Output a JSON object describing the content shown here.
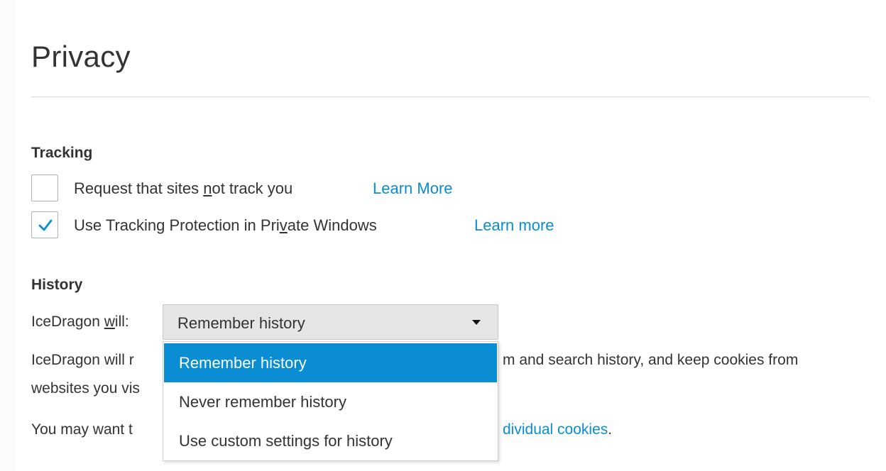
{
  "page": {
    "title": "Privacy"
  },
  "tracking": {
    "heading": "Tracking",
    "dnt": {
      "checked": false,
      "label_pre": "Request that sites ",
      "label_key": "n",
      "label_post": "ot track you",
      "link": "Learn More"
    },
    "protection": {
      "checked": true,
      "label_pre": "Use Tracking Protection in Pri",
      "label_key": "v",
      "label_post": "ate Windows",
      "link": "Learn more"
    }
  },
  "history": {
    "heading": "History",
    "will_pre": "IceDragon ",
    "will_key": "w",
    "will_post": "ill:",
    "select": {
      "value": "Remember history",
      "arrow_icon": "triangle-down-icon"
    },
    "options": [
      {
        "label": "Remember history",
        "selected": true
      },
      {
        "label": "Never remember history",
        "selected": false
      },
      {
        "label": "Use custom settings for history",
        "selected": false
      }
    ],
    "desc_line1_left": "IceDragon will r",
    "desc_line1_right": "m and search history, and keep cookies from",
    "desc_line2": "websites you vis",
    "hint_left": "You may want t",
    "hint_link": "dividual cookies",
    "hint_end": "."
  },
  "colors": {
    "accent": "#0a8dd3",
    "text": "#333333",
    "select_bg": "#e6e6e6"
  }
}
